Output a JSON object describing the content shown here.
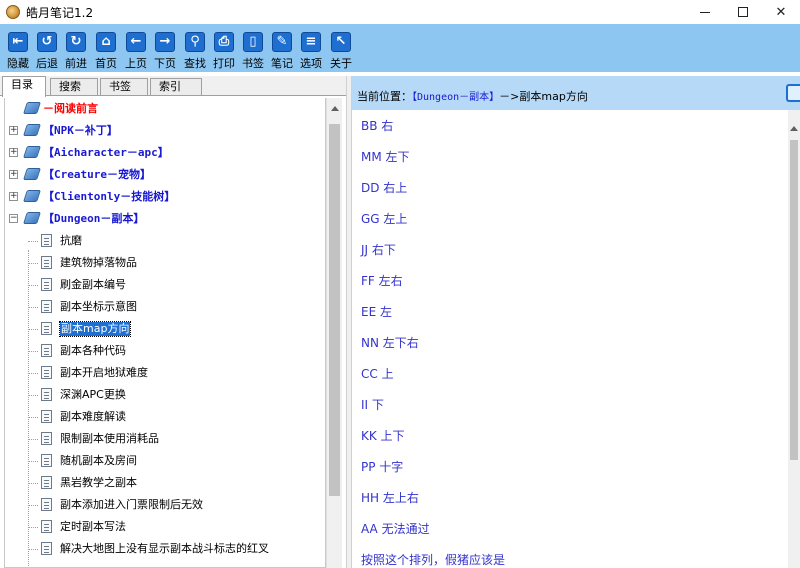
{
  "window": {
    "title": "皓月笔记1.2",
    "minimize_label": "—",
    "maximize_label": "□",
    "close_label": "✕"
  },
  "toolbar": {
    "buttons": [
      {
        "label": "隐藏",
        "icon": "hide-panel-icon",
        "glyph": "⇤"
      },
      {
        "label": "后退",
        "icon": "back-icon",
        "glyph": "↺"
      },
      {
        "label": "前进",
        "icon": "forward-icon",
        "glyph": "↻"
      },
      {
        "label": "首页",
        "icon": "home-icon",
        "glyph": "⌂"
      },
      {
        "label": "上页",
        "icon": "previous-page-icon",
        "glyph": "←"
      },
      {
        "label": "下页",
        "icon": "next-page-icon",
        "glyph": "→"
      },
      {
        "label": "查找",
        "icon": "search-icon",
        "glyph": "⚲"
      },
      {
        "label": "打印",
        "icon": "print-icon",
        "glyph": "⎙"
      },
      {
        "label": "书签",
        "icon": "bookmark-icon",
        "glyph": "▯"
      },
      {
        "label": "笔记",
        "icon": "note-icon",
        "glyph": "✎"
      },
      {
        "label": "选项",
        "icon": "options-icon",
        "glyph": "≡"
      },
      {
        "label": "关于",
        "icon": "about-icon",
        "glyph": "↖"
      }
    ]
  },
  "tabs": [
    {
      "label": "目录",
      "active": true
    },
    {
      "label": "搜索",
      "active": false
    },
    {
      "label": "书签",
      "active": false
    },
    {
      "label": "索引",
      "active": false
    }
  ],
  "tree": {
    "top_items": [
      {
        "label": "－阅读前言",
        "style": "red",
        "expander": ""
      },
      {
        "label": "【NPK－补丁】",
        "style": "blue",
        "expander": "+"
      },
      {
        "label": "【Aicharacter－apc】",
        "style": "blue",
        "expander": "+"
      },
      {
        "label": "【Creature－宠物】",
        "style": "blue",
        "expander": "+"
      },
      {
        "label": "【Clientonly－技能树】",
        "style": "blue",
        "expander": "+"
      },
      {
        "label": "【Dungeon－副本】",
        "style": "blue",
        "expander": "−"
      }
    ],
    "children": [
      {
        "label": "抗磨",
        "selected": false
      },
      {
        "label": "建筑物掉落物品",
        "selected": false
      },
      {
        "label": "刷金副本编号",
        "selected": false
      },
      {
        "label": "副本坐标示意图",
        "selected": false
      },
      {
        "label": "副本map方向",
        "selected": true
      },
      {
        "label": "副本各种代码",
        "selected": false
      },
      {
        "label": "副本开启地狱难度",
        "selected": false
      },
      {
        "label": "深渊APC更换",
        "selected": false
      },
      {
        "label": "副本难度解读",
        "selected": false
      },
      {
        "label": "限制副本使用消耗品",
        "selected": false
      },
      {
        "label": "随机副本及房间",
        "selected": false
      },
      {
        "label": "黑岩教学之副本",
        "selected": false
      },
      {
        "label": "副本添加进入门票限制后无效",
        "selected": false
      },
      {
        "label": "定时副本写法",
        "selected": false
      },
      {
        "label": "解决大地图上没有显示副本战斗标志的红叉",
        "selected": false
      }
    ]
  },
  "location": {
    "prefix": "当前位置：",
    "path": "【Dungeon－副本】",
    "separator": "－>",
    "current": "副本map方向"
  },
  "content": {
    "lines": [
      "BB 右",
      "MM 左下",
      "DD 右上",
      "GG 左上",
      "JJ 右下",
      "FF 左右",
      "EE 左",
      "NN 左下右",
      "CC 上",
      "II 下",
      "KK 上下",
      "PP 十字",
      "HH 左上右",
      "AA 无法通过",
      "按照这个排列，假猪应该是"
    ]
  },
  "colors": {
    "toolbar_bg": "#8ec6f2",
    "location_bg": "#b6d9f7",
    "content_text": "#3333cc",
    "tree_blue": "#1919d2",
    "tree_red": "#ff0000",
    "selection": "#1e6fd0"
  }
}
